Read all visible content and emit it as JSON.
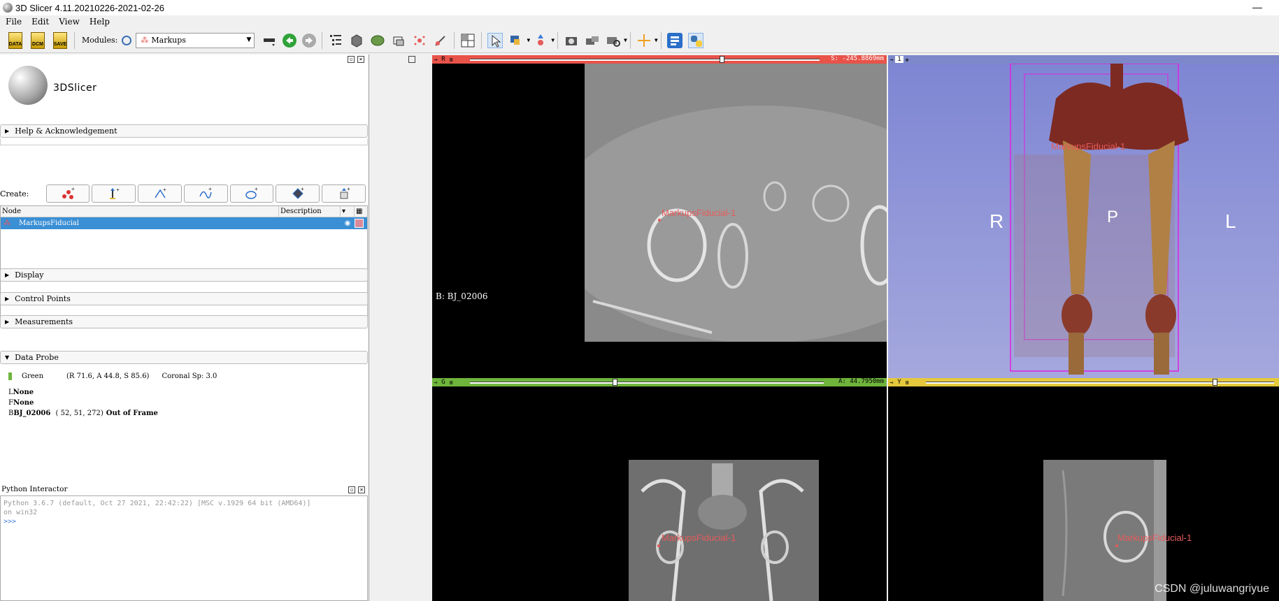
{
  "window": {
    "title": "3D Slicer 4.11.20210226-2021-02-26"
  },
  "menu": [
    "File",
    "Edit",
    "View",
    "Help"
  ],
  "toolbar": {
    "data_label": "DATA",
    "dcm_label": "DCM",
    "save_label": "SAVE",
    "modules_label": "Modules:",
    "module_value": "Markups"
  },
  "left": {
    "logo_text": "3DSlicer",
    "sections": {
      "help": "Help & Acknowledgement",
      "display": "Display",
      "control_points": "Control Points",
      "measurements": "Measurements",
      "data_probe": "Data Probe"
    },
    "create_label": "Create:",
    "table": {
      "col_node": "Node",
      "col_description": "Description",
      "rows": [
        {
          "name": "MarkupsFiducial"
        }
      ]
    },
    "probe": {
      "view": "Green",
      "ras": "(R 71.6, A 44.8, S 85.6)",
      "orient": "Coronal Sp: 3.0",
      "l_key": "L",
      "l_val": "None",
      "f_key": "F",
      "f_val": "None",
      "b_key": "B",
      "b_name": "BJ_02006",
      "b_ijk": "( 52,  51, 272)",
      "b_state": "Out of Frame"
    },
    "python": {
      "title": "Python Interactor",
      "line1": "Python 3.6.7 (default, Oct 27 2021, 22:42:22) [MSC v.1929 64 bit (AMD64)]",
      "line2": "on win32",
      "prompt": ">>>"
    }
  },
  "views": {
    "red": {
      "letter": "R",
      "readout": "S: -245.8869mm",
      "slider_fraction": 0.72,
      "volume_label": "B: BJ_02006",
      "fiducial": "MarkupsFiducial-1"
    },
    "three_d": {
      "letter": "1",
      "fiducial": "MarkupsFiducial-1",
      "orient_r": "R",
      "orient_p": "P",
      "orient_l": "L"
    },
    "green": {
      "letter": "G",
      "readout": "A: 44.7950mm",
      "slider_fraction": 0.41,
      "fiducial": "MarkupsFiducial-1"
    },
    "yellow": {
      "letter": "Y",
      "slider_fraction": 0.83,
      "fiducial": "MarkupsFiducial-1"
    }
  },
  "watermark": "CSDN @juluwangriyue",
  "colors": {
    "red_bar": "#e8534a",
    "green_bar": "#6fb53c",
    "yellow_bar": "#e5c93c",
    "blue_bar": "#7c88c9",
    "selection": "#3a8fd5",
    "fiducial": "#e65b5b"
  }
}
